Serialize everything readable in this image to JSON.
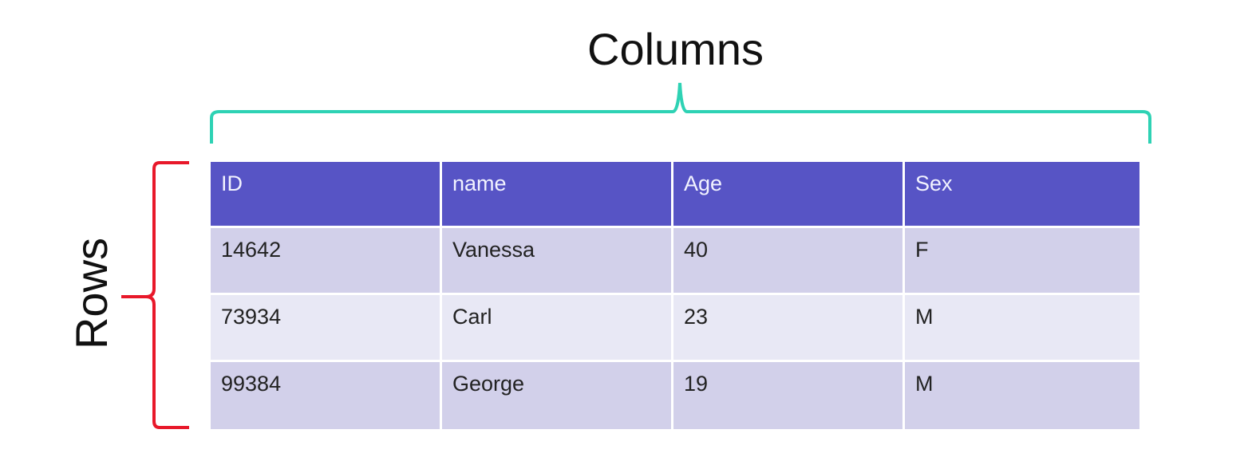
{
  "labels": {
    "columns": "Columns",
    "rows": "Rows"
  },
  "colors": {
    "columns_brace": "#2ed2b4",
    "rows_brace": "#e8182a",
    "header_bg": "#5754c5",
    "row_odd_bg": "#d2d0ea",
    "row_even_bg": "#e8e8f5"
  },
  "table": {
    "headers": [
      "ID",
      "name",
      "Age",
      "Sex"
    ],
    "rows": [
      [
        "14642",
        "Vanessa",
        "40",
        "F"
      ],
      [
        "73934",
        "Carl",
        "23",
        "M"
      ],
      [
        "99384",
        "George",
        "19",
        "M"
      ]
    ]
  }
}
